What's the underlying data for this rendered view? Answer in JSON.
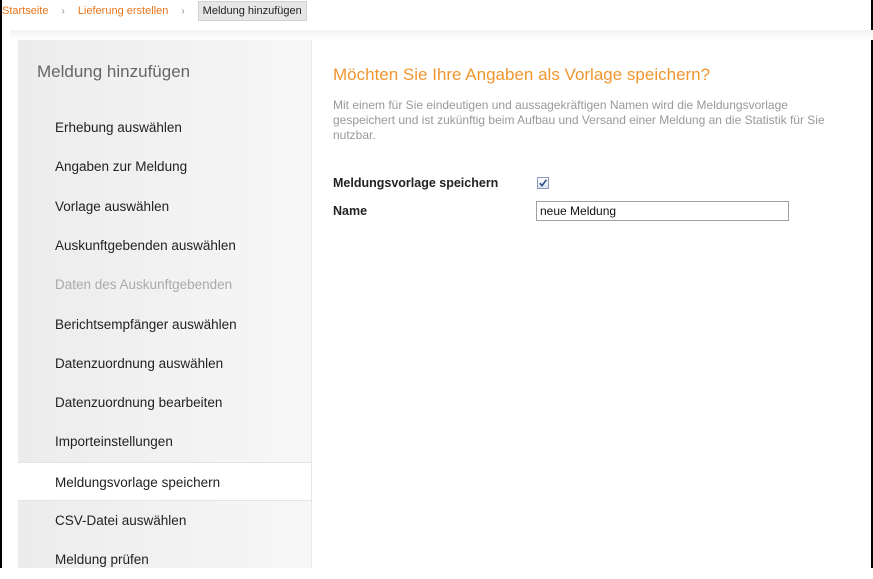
{
  "breadcrumb": {
    "items": [
      "Startseite",
      "Lieferung erstellen"
    ],
    "separator": "›",
    "current": "Meldung hinzufügen"
  },
  "sidebar": {
    "title": "Meldung hinzufügen",
    "items": [
      {
        "label": "Erhebung auswählen"
      },
      {
        "label": "Angaben zur Meldung"
      },
      {
        "label": "Vorlage auswählen"
      },
      {
        "label": "Auskunftgebenden auswählen"
      },
      {
        "label": "Daten des Auskunftgebenden",
        "disabled": true
      },
      {
        "label": "Berichtsempfänger auswählen"
      },
      {
        "label": "Datenzuordnung auswählen"
      },
      {
        "label": "Datenzuordnung bearbeiten"
      },
      {
        "label": "Importeinstellungen"
      },
      {
        "label": "Meldungsvorlage speichern",
        "active": true
      },
      {
        "label": "CSV-Datei auswählen"
      },
      {
        "label": "Meldung prüfen"
      }
    ]
  },
  "main": {
    "title": "Möchten Sie Ihre Angaben als Vorlage speichern?",
    "description": "Mit einem für Sie eindeutigen und aussagekräftigen Namen wird die Meldungsvorlage gespeichert und ist zukünftig beim Aufbau und Versand einer Meldung an die Statistik für Sie nutzbar.",
    "save_template_label": "Meldungsvorlage speichern",
    "save_template_checked": true,
    "name_label": "Name",
    "name_value": "neue Meldung"
  },
  "colors": {
    "accent": "#f0962f",
    "link": "#e8751a"
  }
}
